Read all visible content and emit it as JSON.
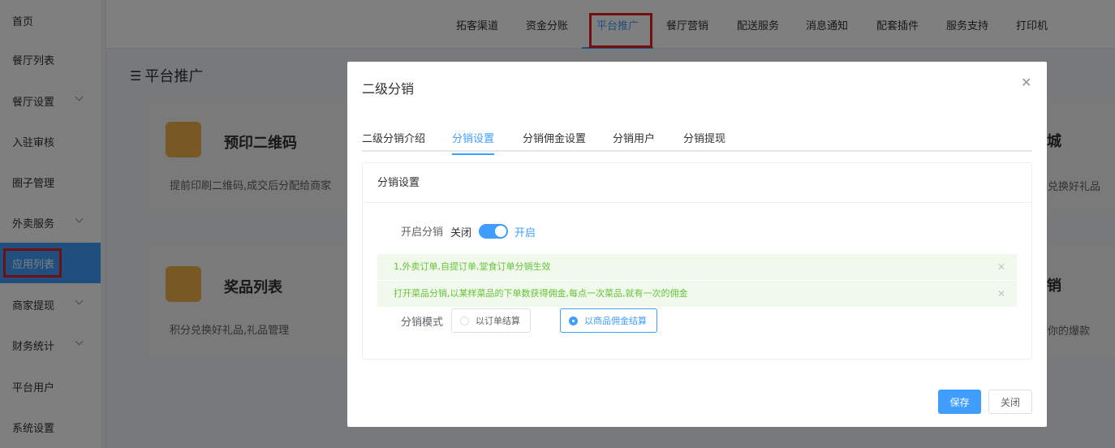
{
  "sidebar": {
    "items": [
      {
        "label": "首页"
      },
      {
        "label": "餐厅列表"
      },
      {
        "label": "餐厅设置",
        "chevron": true
      },
      {
        "label": "入驻审核"
      },
      {
        "label": "圈子管理"
      },
      {
        "label": "外卖服务",
        "chevron": true
      },
      {
        "label": "应用列表",
        "active": true
      },
      {
        "label": "商家提现",
        "chevron": true
      },
      {
        "label": "财务统计",
        "chevron": true
      },
      {
        "label": "平台用户"
      },
      {
        "label": "系统设置"
      }
    ]
  },
  "topnav": {
    "items": [
      "拓客渠道",
      "资金分账",
      "平台推广",
      "餐厅营销",
      "配送服务",
      "消息通知",
      "配套插件",
      "服务支持",
      "打印机"
    ],
    "active": "平台推广"
  },
  "page": {
    "title": "平台推广",
    "cards": [
      {
        "title": "预印二维码",
        "desc": "提前印刷二维码,成交后分配给商家"
      },
      {
        "title": "奖品列表",
        "desc": "积分兑换好礼品,礼品管理"
      }
    ],
    "right_fragments": {
      "top_title": "城",
      "top_desc": "兑换好礼品",
      "bottom_title": "销",
      "bottom_desc": "你的爆款"
    }
  },
  "dialog": {
    "title": "二级分销",
    "tabs": [
      "二级分销介绍",
      "分销设置",
      "分销佣金设置",
      "分销用户",
      "分销提现"
    ],
    "active_tab": "分销设置",
    "panel": {
      "heading": "分销设置",
      "enable_label": "开启分销",
      "switch_off": "关闭",
      "switch_on": "开启",
      "switch_value": true,
      "alerts": [
        "1,外卖订单,自提订单,堂食订单分销生效",
        "打开菜品分销,以某样菜品的下单数获得佣金,每点一次菜品,就有一次的佣金"
      ],
      "mode_label": "分销模式",
      "mode_options": [
        "以订单结算",
        "以商品佣金结算"
      ],
      "mode_selected": "以商品佣金结算"
    },
    "save": "保存",
    "close": "关闭"
  },
  "colors": {
    "primary": "#409eff",
    "highlight": "#e02020",
    "alert_bg": "#f0f9eb",
    "alert_text": "#67c23a",
    "icon_orange": "#f0b34a"
  }
}
